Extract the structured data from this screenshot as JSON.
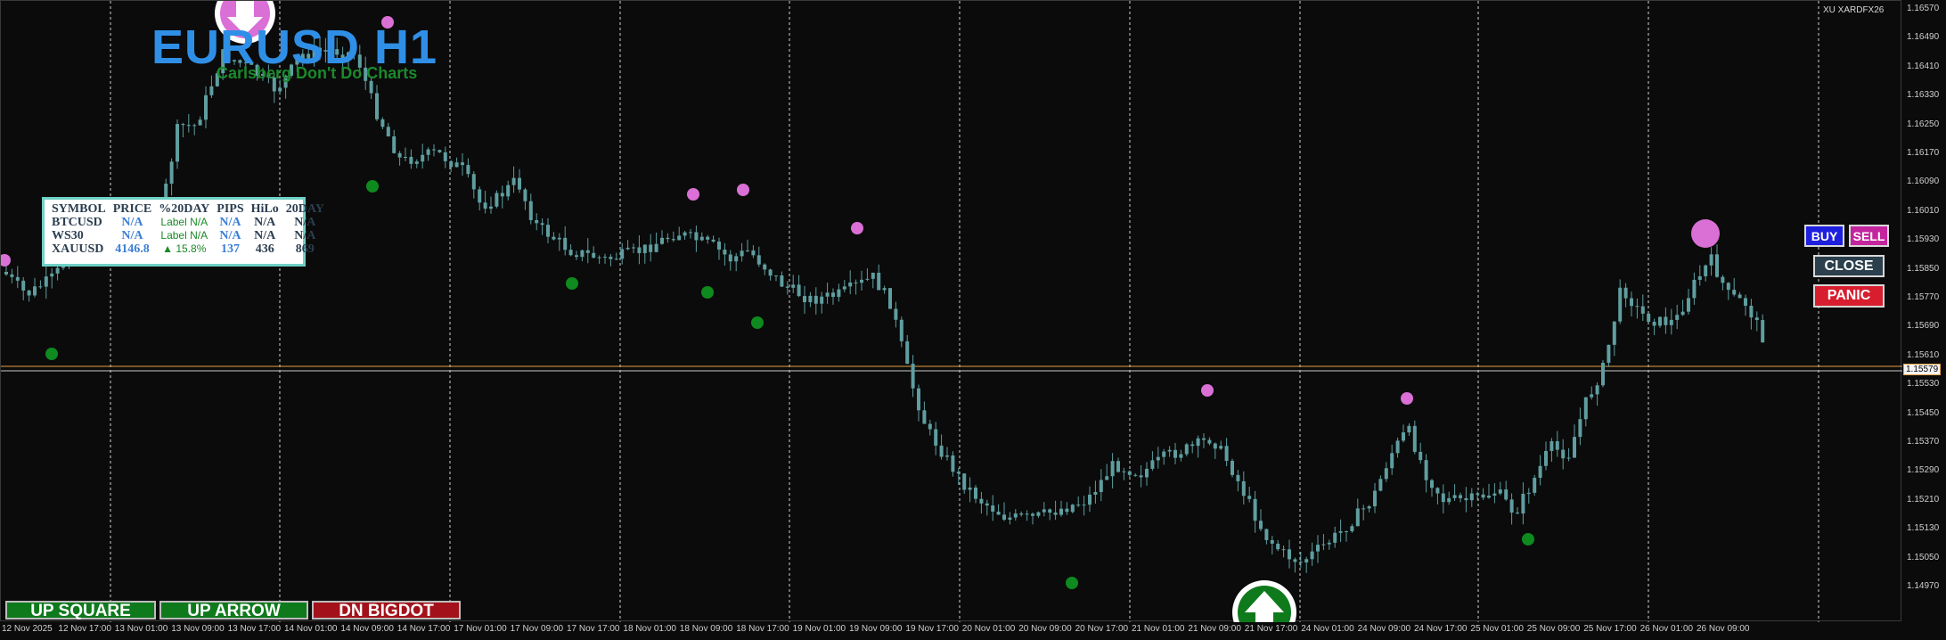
{
  "header": {
    "title": "EURUSD H1",
    "subtitle": "Carlsberg Don't Do Charts",
    "broker": "XU XARDFX26"
  },
  "colors": {
    "background": "#0b0b0b",
    "candle": "#5f9ea0",
    "title": "#2f8fe6",
    "subtitle": "#1b8a2a",
    "marker_high": "#da70d6",
    "marker_low": "#0e8a1f",
    "price_line": "#e6a040"
  },
  "price_axis": {
    "labels": [
      "1.16570",
      "1.16490",
      "1.16410",
      "1.16330",
      "1.16250",
      "1.16170",
      "1.16090",
      "1.16010",
      "1.15930",
      "1.15850",
      "1.15770",
      "1.15690",
      "1.15610",
      "1.15530",
      "1.15450",
      "1.15370",
      "1.15290",
      "1.15210",
      "1.15130",
      "1.15050",
      "1.14970"
    ],
    "current": "1.15579"
  },
  "time_axis": {
    "labels": [
      "12 Nov 2025",
      "12 Nov 17:00",
      "13 Nov 01:00",
      "13 Nov 09:00",
      "13 Nov 17:00",
      "14 Nov 01:00",
      "14 Nov 09:00",
      "14 Nov 17:00",
      "17 Nov 01:00",
      "17 Nov 09:00",
      "17 Nov 17:00",
      "18 Nov 01:00",
      "18 Nov 09:00",
      "18 Nov 17:00",
      "19 Nov 01:00",
      "19 Nov 09:00",
      "19 Nov 17:00",
      "20 Nov 01:00",
      "20 Nov 09:00",
      "20 Nov 17:00",
      "21 Nov 01:00",
      "21 Nov 09:00",
      "21 Nov 17:00",
      "24 Nov 01:00",
      "24 Nov 09:00",
      "24 Nov 17:00",
      "25 Nov 01:00",
      "25 Nov 09:00",
      "25 Nov 17:00",
      "26 Nov 01:00",
      "26 Nov 09:00"
    ]
  },
  "panel": {
    "headers": [
      "SYMBOL",
      "PRICE",
      "%20DAY",
      "PIPS",
      "HiLo",
      "20DAY"
    ],
    "rows": [
      {
        "symbol": "BTCUSD",
        "price": "N/A",
        "pct": "Label",
        "pips": "N/A",
        "hilo": "N/A",
        "day20": "N/A",
        "pct_b": "N/A"
      },
      {
        "symbol": "WS30",
        "price": "N/A",
        "pct": "Label",
        "pips": "N/A",
        "hilo": "N/A",
        "day20": "N/A",
        "pct_b": "N/A"
      },
      {
        "symbol": "XAUUSD",
        "price": "4146.8",
        "pct": "▲ 15.8%",
        "pips": "137",
        "hilo": "436",
        "day20": "869",
        "pct_b": ""
      }
    ]
  },
  "trade_buttons": {
    "buy": "BUY",
    "sell": "SELL",
    "close": "CLOSE",
    "panic": "PANIC"
  },
  "signal_buttons": {
    "up_square": "UP SQUARE",
    "up_arrow": "UP ARROW",
    "dn_bigdot": "DN BIGDOT"
  }
}
